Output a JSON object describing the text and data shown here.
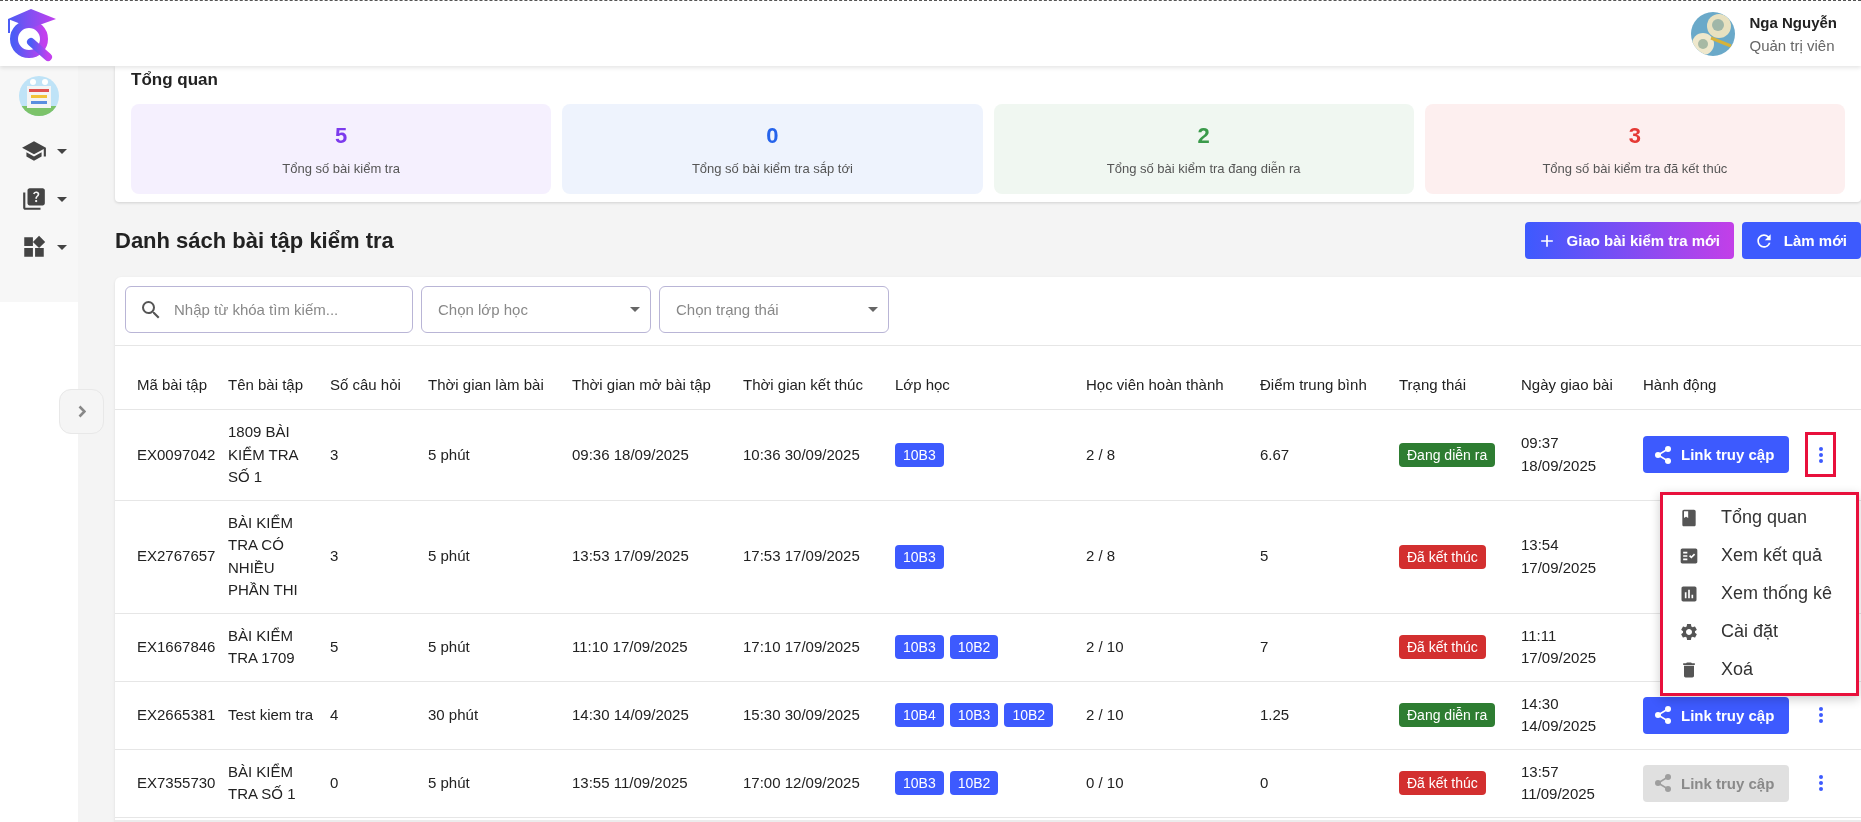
{
  "header": {
    "user_name": "Nga Nguyễn",
    "user_role": "Quản trị viên"
  },
  "overview": {
    "title": "Tổng quan",
    "stats": [
      {
        "value": "5",
        "label": "Tổng số bài kiểm tra",
        "color": "#7c3aed"
      },
      {
        "value": "0",
        "label": "Tổng số bài kiểm tra sắp tới",
        "color": "#2563eb"
      },
      {
        "value": "2",
        "label": "Tổng số bài kiểm tra đang diễn ra",
        "color": "#3a9a4a"
      },
      {
        "value": "3",
        "label": "Tổng số bài kiểm tra đã kết thúc",
        "color": "#e53935"
      }
    ]
  },
  "list": {
    "title": "Danh sách bài tập kiểm tra",
    "buttons": [
      {
        "label": "Giao bài kiểm tra mới",
        "kind": "assign"
      },
      {
        "label": "Làm mới",
        "kind": "refresh"
      }
    ]
  },
  "filters": {
    "search_placeholder": "Nhập từ khóa tìm kiếm...",
    "selects": [
      {
        "placeholder": "Chọn lớp học"
      },
      {
        "placeholder": "Chọn trạng thái"
      }
    ]
  },
  "table": {
    "columns": [
      "Mã bài tập",
      "Tên bài tập",
      "Số câu hỏi",
      "Thời gian làm bài",
      "Thời gian mở bài tập",
      "Thời gian kết thúc",
      "Lớp học",
      "Học viên hoàn thành",
      "Điểm trung bình",
      "Trạng thái",
      "Ngày giao bài",
      "Hành động"
    ],
    "rows": [
      {
        "code": "EX0097042",
        "name": "1809 BÀI KIỂM TRA SỐ 1",
        "questions": "3",
        "duration": "5 phút",
        "open": "09:36 18/09/2025",
        "close": "10:36 30/09/2025",
        "classes": [
          "10B3"
        ],
        "completed": "2 / 8",
        "average": "6.67",
        "status": {
          "label": "Đang diễn ra",
          "kind": "ongoing"
        },
        "assigned": "09:37 18/09/2025",
        "link": {
          "label": "Link truy cập",
          "disabled": false
        },
        "menu_open": true
      },
      {
        "code": "EX2767657",
        "name": "BÀI KIỂM TRA CÓ NHIỀU PHẦN THI",
        "questions": "3",
        "duration": "5 phút",
        "open": "13:53 17/09/2025",
        "close": "17:53 17/09/2025",
        "classes": [
          "10B3"
        ],
        "completed": "2 / 8",
        "average": "5",
        "status": {
          "label": "Đã kết thúc",
          "kind": "ended"
        },
        "assigned": "13:54 17/09/2025"
      },
      {
        "code": "EX1667846",
        "name": "BÀI KIỂM TRA 1709",
        "questions": "5",
        "duration": "5 phút",
        "open": "11:10 17/09/2025",
        "close": "17:10 17/09/2025",
        "classes": [
          "10B3",
          "10B2"
        ],
        "completed": "2 / 10",
        "average": "7",
        "status": {
          "label": "Đã kết thúc",
          "kind": "ended"
        },
        "assigned": "11:11 17/09/2025"
      },
      {
        "code": "EX2665381",
        "name": "Test kiem tra",
        "questions": "4",
        "duration": "30 phút",
        "open": "14:30 14/09/2025",
        "close": "15:30 30/09/2025",
        "classes": [
          "10B4",
          "10B3",
          "10B2"
        ],
        "completed": "2 / 10",
        "average": "1.25",
        "status": {
          "label": "Đang diễn ra",
          "kind": "ongoing"
        },
        "assigned": "14:30 14/09/2025",
        "link": {
          "label": "Link truy cập",
          "disabled": false
        },
        "menu_open": false
      },
      {
        "code": "EX7355730",
        "name": "BÀI KIỂM TRA SỐ 1",
        "questions": "0",
        "duration": "5 phút",
        "open": "13:55 11/09/2025",
        "close": "17:00 12/09/2025",
        "classes": [
          "10B3",
          "10B2"
        ],
        "completed": "0 / 10",
        "average": "0",
        "status": {
          "label": "Đã kết thúc",
          "kind": "ended"
        },
        "assigned": "13:57 11/09/2025",
        "link": {
          "label": "Link truy cập",
          "disabled": true
        },
        "menu_open": false
      }
    ]
  },
  "menu": {
    "items": [
      {
        "label": "Tổng quan"
      },
      {
        "label": "Xem kết quả"
      },
      {
        "label": "Xem thống kê"
      },
      {
        "label": "Cài đặt"
      },
      {
        "label": "Xoá"
      }
    ]
  }
}
